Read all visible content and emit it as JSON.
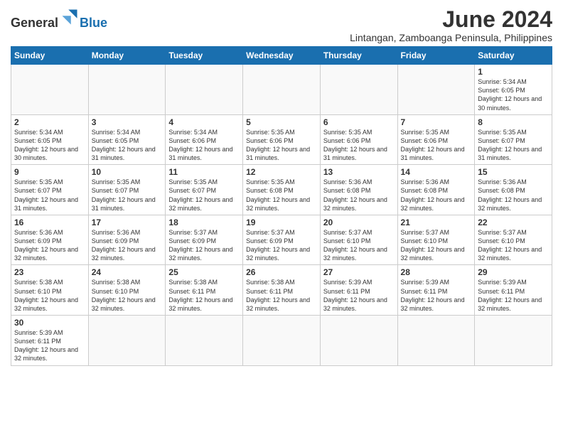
{
  "header": {
    "logo_general": "General",
    "logo_blue": "Blue",
    "month_year": "June 2024",
    "location": "Lintangan, Zamboanga Peninsula, Philippines"
  },
  "days_of_week": [
    "Sunday",
    "Monday",
    "Tuesday",
    "Wednesday",
    "Thursday",
    "Friday",
    "Saturday"
  ],
  "weeks": [
    [
      {
        "day": "",
        "info": ""
      },
      {
        "day": "",
        "info": ""
      },
      {
        "day": "",
        "info": ""
      },
      {
        "day": "",
        "info": ""
      },
      {
        "day": "",
        "info": ""
      },
      {
        "day": "",
        "info": ""
      },
      {
        "day": "1",
        "info": "Sunrise: 5:34 AM\nSunset: 6:05 PM\nDaylight: 12 hours and 30 minutes."
      }
    ],
    [
      {
        "day": "2",
        "info": "Sunrise: 5:34 AM\nSunset: 6:05 PM\nDaylight: 12 hours and 30 minutes."
      },
      {
        "day": "3",
        "info": "Sunrise: 5:34 AM\nSunset: 6:05 PM\nDaylight: 12 hours and 31 minutes."
      },
      {
        "day": "4",
        "info": "Sunrise: 5:34 AM\nSunset: 6:06 PM\nDaylight: 12 hours and 31 minutes."
      },
      {
        "day": "5",
        "info": "Sunrise: 5:35 AM\nSunset: 6:06 PM\nDaylight: 12 hours and 31 minutes."
      },
      {
        "day": "6",
        "info": "Sunrise: 5:35 AM\nSunset: 6:06 PM\nDaylight: 12 hours and 31 minutes."
      },
      {
        "day": "7",
        "info": "Sunrise: 5:35 AM\nSunset: 6:06 PM\nDaylight: 12 hours and 31 minutes."
      },
      {
        "day": "8",
        "info": "Sunrise: 5:35 AM\nSunset: 6:07 PM\nDaylight: 12 hours and 31 minutes."
      }
    ],
    [
      {
        "day": "9",
        "info": "Sunrise: 5:35 AM\nSunset: 6:07 PM\nDaylight: 12 hours and 31 minutes."
      },
      {
        "day": "10",
        "info": "Sunrise: 5:35 AM\nSunset: 6:07 PM\nDaylight: 12 hours and 31 minutes."
      },
      {
        "day": "11",
        "info": "Sunrise: 5:35 AM\nSunset: 6:07 PM\nDaylight: 12 hours and 32 minutes."
      },
      {
        "day": "12",
        "info": "Sunrise: 5:35 AM\nSunset: 6:08 PM\nDaylight: 12 hours and 32 minutes."
      },
      {
        "day": "13",
        "info": "Sunrise: 5:36 AM\nSunset: 6:08 PM\nDaylight: 12 hours and 32 minutes."
      },
      {
        "day": "14",
        "info": "Sunrise: 5:36 AM\nSunset: 6:08 PM\nDaylight: 12 hours and 32 minutes."
      },
      {
        "day": "15",
        "info": "Sunrise: 5:36 AM\nSunset: 6:08 PM\nDaylight: 12 hours and 32 minutes."
      }
    ],
    [
      {
        "day": "16",
        "info": "Sunrise: 5:36 AM\nSunset: 6:09 PM\nDaylight: 12 hours and 32 minutes."
      },
      {
        "day": "17",
        "info": "Sunrise: 5:36 AM\nSunset: 6:09 PM\nDaylight: 12 hours and 32 minutes."
      },
      {
        "day": "18",
        "info": "Sunrise: 5:37 AM\nSunset: 6:09 PM\nDaylight: 12 hours and 32 minutes."
      },
      {
        "day": "19",
        "info": "Sunrise: 5:37 AM\nSunset: 6:09 PM\nDaylight: 12 hours and 32 minutes."
      },
      {
        "day": "20",
        "info": "Sunrise: 5:37 AM\nSunset: 6:10 PM\nDaylight: 12 hours and 32 minutes."
      },
      {
        "day": "21",
        "info": "Sunrise: 5:37 AM\nSunset: 6:10 PM\nDaylight: 12 hours and 32 minutes."
      },
      {
        "day": "22",
        "info": "Sunrise: 5:37 AM\nSunset: 6:10 PM\nDaylight: 12 hours and 32 minutes."
      }
    ],
    [
      {
        "day": "23",
        "info": "Sunrise: 5:38 AM\nSunset: 6:10 PM\nDaylight: 12 hours and 32 minutes."
      },
      {
        "day": "24",
        "info": "Sunrise: 5:38 AM\nSunset: 6:10 PM\nDaylight: 12 hours and 32 minutes."
      },
      {
        "day": "25",
        "info": "Sunrise: 5:38 AM\nSunset: 6:11 PM\nDaylight: 12 hours and 32 minutes."
      },
      {
        "day": "26",
        "info": "Sunrise: 5:38 AM\nSunset: 6:11 PM\nDaylight: 12 hours and 32 minutes."
      },
      {
        "day": "27",
        "info": "Sunrise: 5:39 AM\nSunset: 6:11 PM\nDaylight: 12 hours and 32 minutes."
      },
      {
        "day": "28",
        "info": "Sunrise: 5:39 AM\nSunset: 6:11 PM\nDaylight: 12 hours and 32 minutes."
      },
      {
        "day": "29",
        "info": "Sunrise: 5:39 AM\nSunset: 6:11 PM\nDaylight: 12 hours and 32 minutes."
      }
    ],
    [
      {
        "day": "30",
        "info": "Sunrise: 5:39 AM\nSunset: 6:11 PM\nDaylight: 12 hours and 32 minutes."
      },
      {
        "day": "",
        "info": ""
      },
      {
        "day": "",
        "info": ""
      },
      {
        "day": "",
        "info": ""
      },
      {
        "day": "",
        "info": ""
      },
      {
        "day": "",
        "info": ""
      },
      {
        "day": "",
        "info": ""
      }
    ]
  ]
}
